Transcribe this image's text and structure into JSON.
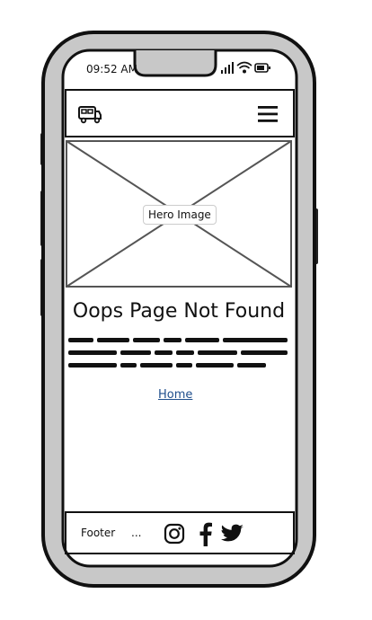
{
  "status_bar": {
    "time": "09:52 AM",
    "icons": [
      "signal-icon",
      "wifi-icon",
      "battery-icon"
    ]
  },
  "header": {
    "logo_icon": "camper-van-icon",
    "menu_icon": "hamburger-menu-icon"
  },
  "hero": {
    "label": "Hero Image"
  },
  "main": {
    "title": "Oops Page Not Found",
    "home_link": "Home"
  },
  "footer": {
    "label": "Footer",
    "more": "...",
    "social_icons": [
      "instagram-icon",
      "facebook-icon",
      "twitter-icon"
    ]
  },
  "colors": {
    "frame_gray": "#c8c8c8",
    "ink": "#111111",
    "link": "#1f4e8c"
  }
}
